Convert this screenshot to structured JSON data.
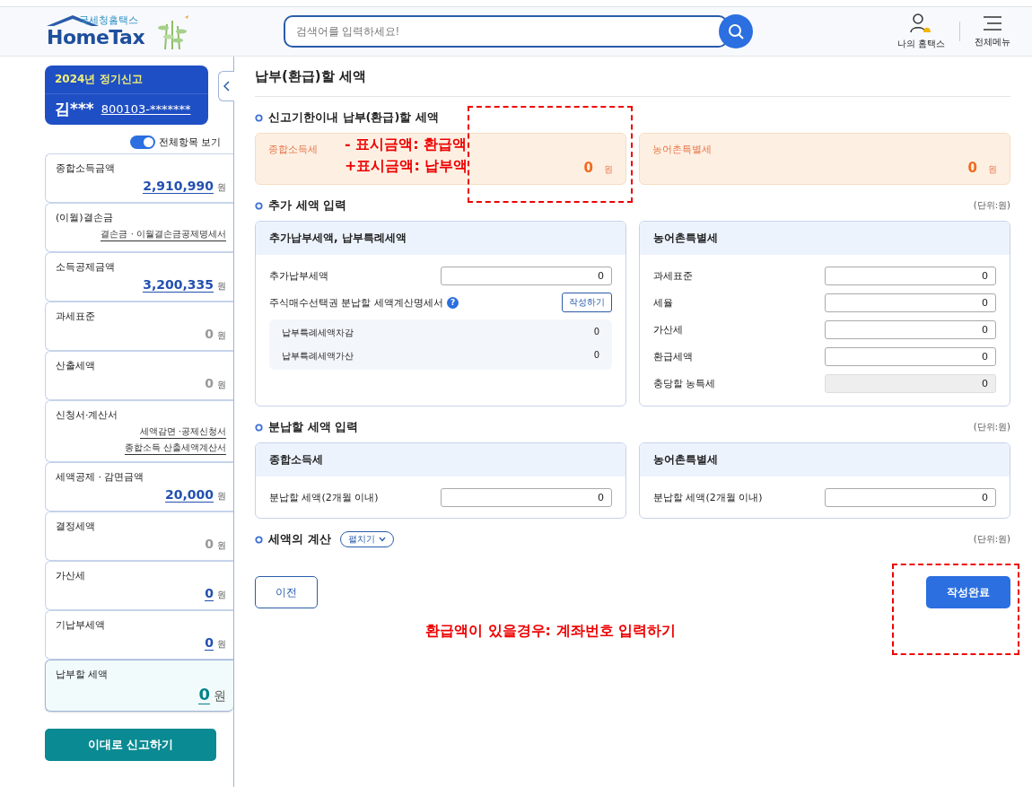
{
  "header": {
    "logo": {
      "caption": "국세청홈택스",
      "name": "HomeTax"
    },
    "search": {
      "placeholder": "검색어를 입력하세요!"
    },
    "links": [
      {
        "kind": "user",
        "label": "나의 홈택스"
      },
      {
        "kind": "menu",
        "label": "전체메뉴"
      }
    ]
  },
  "sidebar": {
    "period": "2024년 정기신고",
    "person": {
      "name": "김***",
      "id": "800103-*******"
    },
    "toggle": {
      "label": "전체항목 보기",
      "on": true
    },
    "items": [
      {
        "label": "종합소득금액",
        "kind": "amount",
        "amount": "2,910,990",
        "unit": "원",
        "linked": true,
        "selected": false
      },
      {
        "label": "(이월)결손금",
        "kind": "links",
        "links": [
          "결손금 · 이월결손금공제명세서"
        ],
        "selected": false
      },
      {
        "label": "소득공제금액",
        "kind": "amount",
        "amount": "3,200,335",
        "unit": "원",
        "linked": true,
        "selected": false
      },
      {
        "label": "과세표준",
        "kind": "amount",
        "amount": "0",
        "unit": "원",
        "linked": false,
        "selected": false
      },
      {
        "label": "산출세액",
        "kind": "amount",
        "amount": "0",
        "unit": "원",
        "linked": false,
        "selected": false
      },
      {
        "label": "신청서·계산서",
        "kind": "links",
        "links": [
          "세액감면 ·공제신청서",
          "종합소득 산출세액계산서"
        ],
        "selected": false
      },
      {
        "label": "세액공제 · 감면금액",
        "kind": "amount",
        "amount": "20,000",
        "unit": "원",
        "linked": true,
        "selected": false
      },
      {
        "label": "결정세액",
        "kind": "amount",
        "amount": "0",
        "unit": "원",
        "linked": false,
        "selected": false
      },
      {
        "label": "가산세",
        "kind": "amount",
        "amount": "0",
        "unit": "원",
        "linked": true,
        "selected": false
      },
      {
        "label": "기납부세액",
        "kind": "amount",
        "amount": "0",
        "unit": "원",
        "linked": true,
        "selected": false
      },
      {
        "label": "납부할 세액",
        "kind": "amount",
        "amount": "0",
        "unit": "원",
        "linked": true,
        "selected": true
      }
    ],
    "submit_button": "이대로 신고하기"
  },
  "main": {
    "title": "납부(환급)할 세액",
    "sections": [
      {
        "title": "신고기한이내 납부(환급)할 세액",
        "kind": "summary",
        "cards": [
          {
            "label": "종합소득세",
            "amount": "0",
            "unit": "원"
          },
          {
            "label": "농어촌특별세",
            "amount": "0",
            "unit": "원"
          }
        ]
      },
      {
        "title": "추가 세액 입력",
        "kind": "panels",
        "unit": "(단위:원)",
        "panels": [
          {
            "title": "추가납부세액, 납부특례세액",
            "rows": [
              {
                "kind": "input",
                "label": "추가납부세액",
                "value": "0"
              },
              {
                "kind": "action",
                "label": "주식매수선택권 분납할 세액계산명세서",
                "help": "?",
                "button": "작성하기"
              },
              {
                "kind": "subtable",
                "rows": [
                  {
                    "label": "납부특례세액차감",
                    "value": "0"
                  },
                  {
                    "label": "납부특례세액가산",
                    "value": "0"
                  }
                ]
              }
            ]
          },
          {
            "title": "농어촌특별세",
            "rows": [
              {
                "kind": "input",
                "label": "과세표준",
                "value": "0",
                "disabled": false
              },
              {
                "kind": "input",
                "label": "세율",
                "value": "0",
                "disabled": false
              },
              {
                "kind": "input",
                "label": "가산세",
                "value": "0",
                "disabled": false
              },
              {
                "kind": "input",
                "label": "환급세액",
                "value": "0",
                "disabled": false
              },
              {
                "kind": "input",
                "label": "충당할 농특세",
                "value": "0",
                "disabled": true
              }
            ]
          }
        ]
      },
      {
        "title": "분납할 세액 입력",
        "kind": "panels",
        "unit": "(단위:원)",
        "panels": [
          {
            "title": "종합소득세",
            "rows": [
              {
                "kind": "input",
                "label": "분납할 세액(2개월 이내)",
                "value": "0",
                "disabled": false
              }
            ]
          },
          {
            "title": "농어촌특별세",
            "rows": [
              {
                "kind": "input",
                "label": "분납할 세액(2개월 이내)",
                "value": "0",
                "disabled": false
              }
            ]
          }
        ]
      },
      {
        "title": "세액의 계산",
        "kind": "collapsed",
        "unit": "(단위:원)",
        "expand_button": "펼치기"
      }
    ],
    "buttons": [
      {
        "kind": "secondary",
        "label": "이전"
      },
      {
        "kind": "primary",
        "label": "작성완료"
      }
    ]
  },
  "annotations": [
    {
      "kind": "note",
      "lines": [
        "- 표시금액: 환급액",
        "+표시금액: 납부액"
      ]
    },
    {
      "kind": "box"
    },
    {
      "kind": "note",
      "lines": [
        "환급액이 있을경우: 계좌번호 입력하기"
      ]
    },
    {
      "kind": "box"
    }
  ]
}
